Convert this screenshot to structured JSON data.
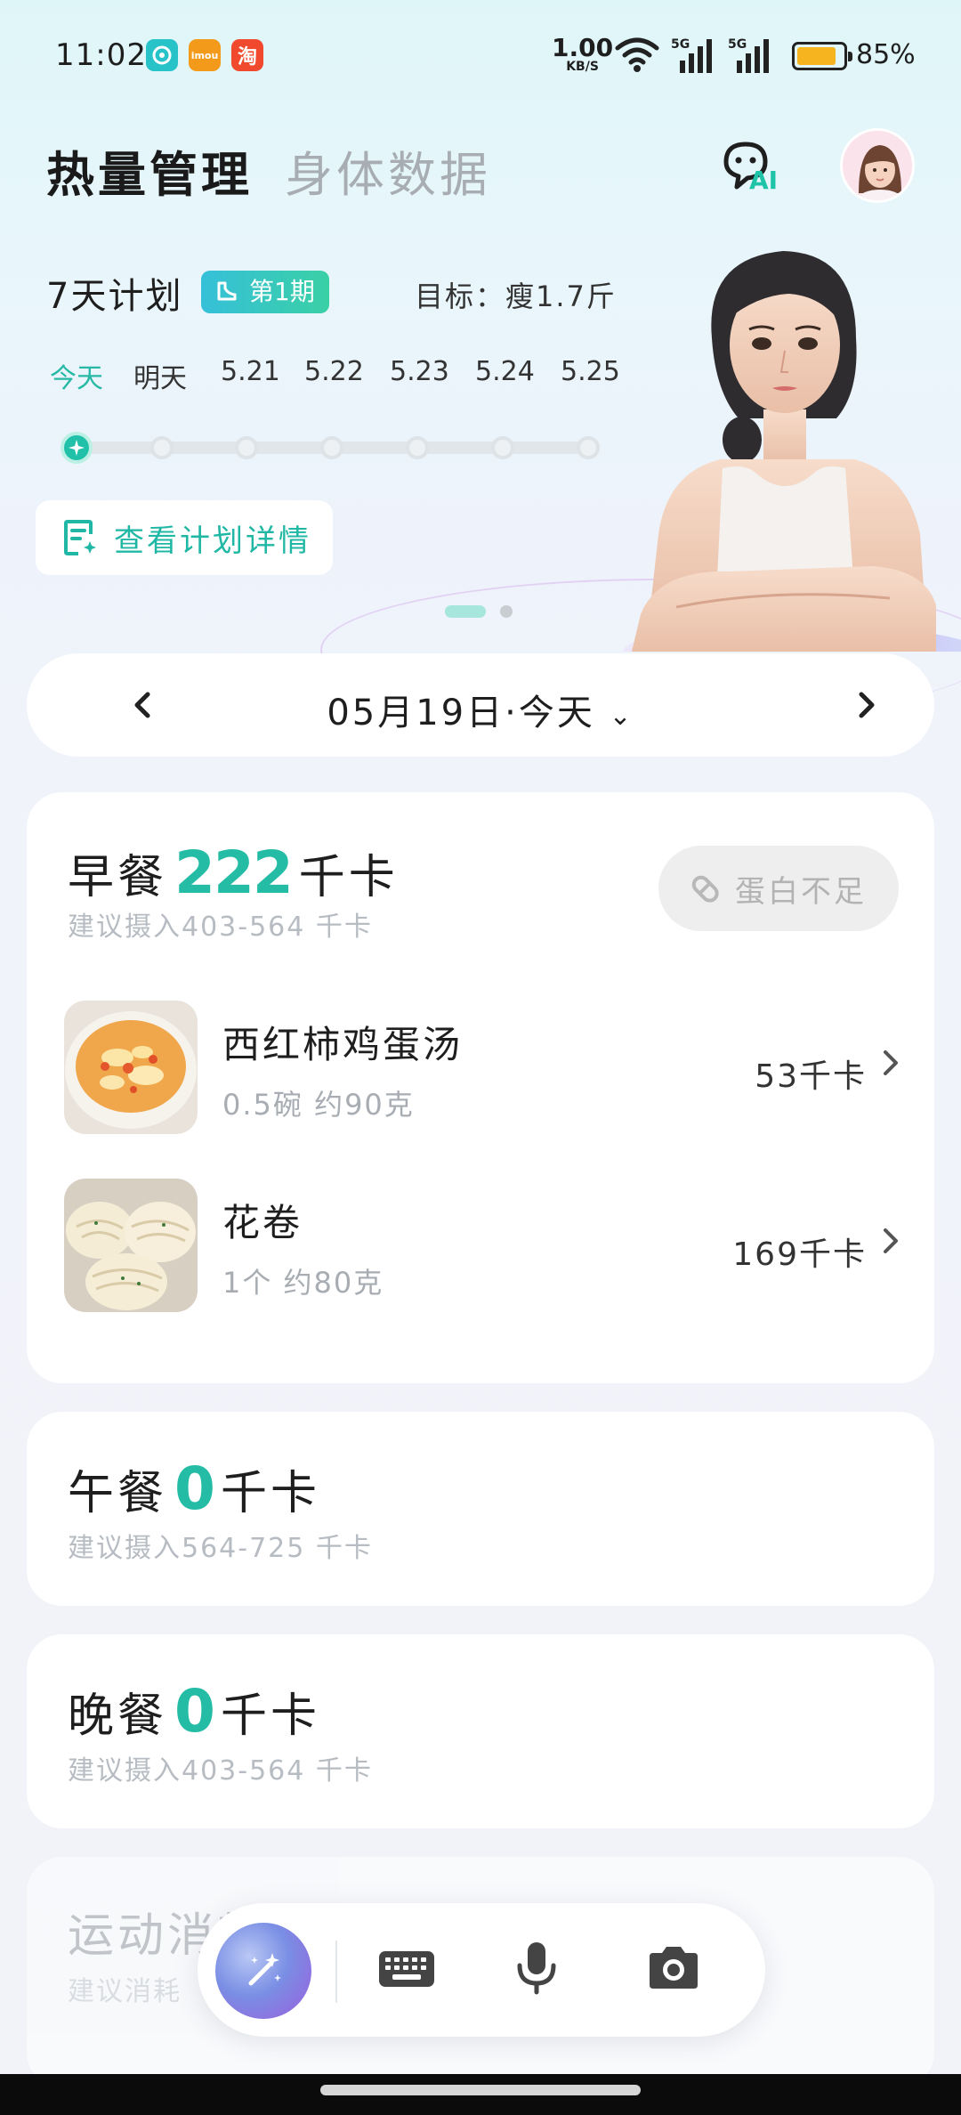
{
  "status_bar": {
    "time": "11:02",
    "net_speed_value": "1.00",
    "net_speed_unit": "KB/S",
    "signal_1": "5G",
    "signal_2": "5G",
    "battery_percent": "85%",
    "battery_level": 0.85,
    "apps": [
      "app-1",
      "imou",
      "淘"
    ]
  },
  "header": {
    "tabs": [
      {
        "label": "热量管理",
        "active": true
      },
      {
        "label": "身体数据",
        "active": false
      }
    ],
    "ai_label": "AI"
  },
  "plan": {
    "title": "7天计划",
    "badge": "第1期",
    "goal": "目标：瘦1.7斤",
    "days": [
      "今天",
      "明天",
      "5.21",
      "5.22",
      "5.23",
      "5.24",
      "5.25"
    ],
    "active_day_index": 0,
    "details_button": "查看计划详情"
  },
  "date_nav": {
    "label": "05月19日·今天",
    "chevron": "⌄"
  },
  "meals": {
    "breakfast": {
      "name": "早餐",
      "kcal": "222",
      "unit": "千卡",
      "suggestion": "建议摄入403-564 千卡",
      "warning": "蛋白不足",
      "items": [
        {
          "name": "西红柿鸡蛋汤",
          "qty": "0.5碗  约90克",
          "kcal": "53千卡"
        },
        {
          "name": "花卷",
          "qty": "1个  约80克",
          "kcal": "169千卡"
        }
      ]
    },
    "lunch": {
      "name": "午餐",
      "kcal": "0",
      "unit": "千卡",
      "suggestion": "建议摄入564-725 千卡"
    },
    "dinner": {
      "name": "晚餐",
      "kcal": "0",
      "unit": "千卡",
      "suggestion": "建议摄入403-564 千卡"
    },
    "exercise": {
      "name": "运动消耗",
      "suggestion": "建议消耗"
    }
  },
  "toolbar": {
    "icons": [
      "magic-wand-icon",
      "keyboard-icon",
      "microphone-icon",
      "camera-icon"
    ]
  },
  "colors": {
    "accent": "#25bca5",
    "badge_gradient_start": "#36c0d9",
    "badge_gradient_end": "#3ad0a5",
    "battery": "#f6b51e"
  }
}
